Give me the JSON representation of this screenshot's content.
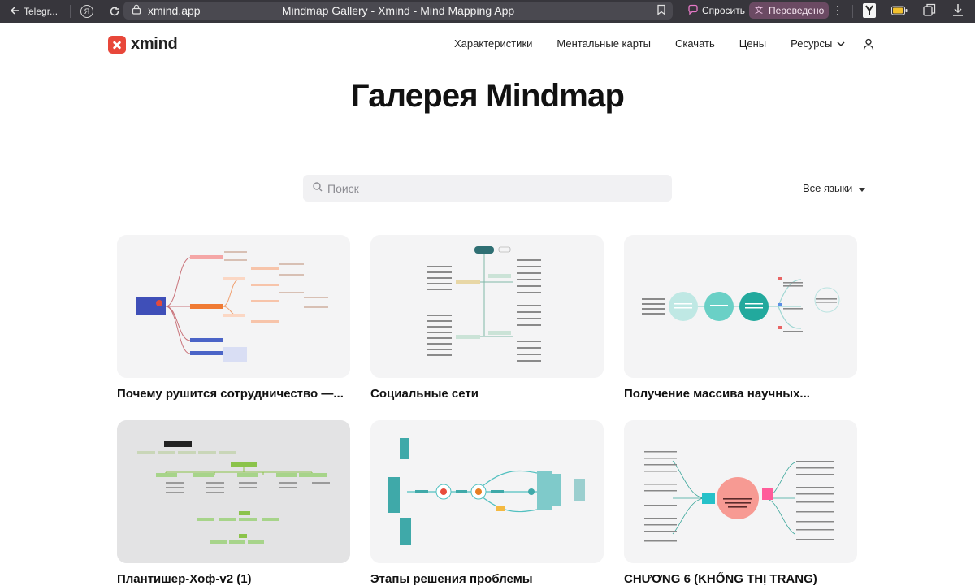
{
  "browser": {
    "back_label": "Telegr...",
    "yandex_icon": "Я",
    "url": "xmind.app",
    "page_title": "Mindmap Gallery - Xmind - Mind Mapping App",
    "ask_label": "Спросить",
    "translated_label": "Переведено",
    "more_icon": "⋮"
  },
  "header": {
    "logo_text": "xmind",
    "nav": [
      "Характеристики",
      "Ментальные карты",
      "Скачать",
      "Цены",
      "Ресурсы"
    ]
  },
  "main": {
    "title": "Галерея Mindmap",
    "search_placeholder": "Поиск",
    "language_selector": "Все языки"
  },
  "cards": [
    {
      "caption": "Почему рушится сотрудничество —..."
    },
    {
      "caption": "Социальные сети"
    },
    {
      "caption": "Получение массива научных..."
    },
    {
      "caption": "Плантишер-Хоф-v2 (1)"
    },
    {
      "caption": "Этапы решения проблемы"
    },
    {
      "caption": "CHƯƠNG 6 (KHỔNG THỊ TRANG)"
    }
  ],
  "colors": {
    "brand": "#e8473a",
    "chrome_bg": "#37363c",
    "card_bg": "#f4f4f5",
    "search_bg": "#f1f1f3"
  }
}
